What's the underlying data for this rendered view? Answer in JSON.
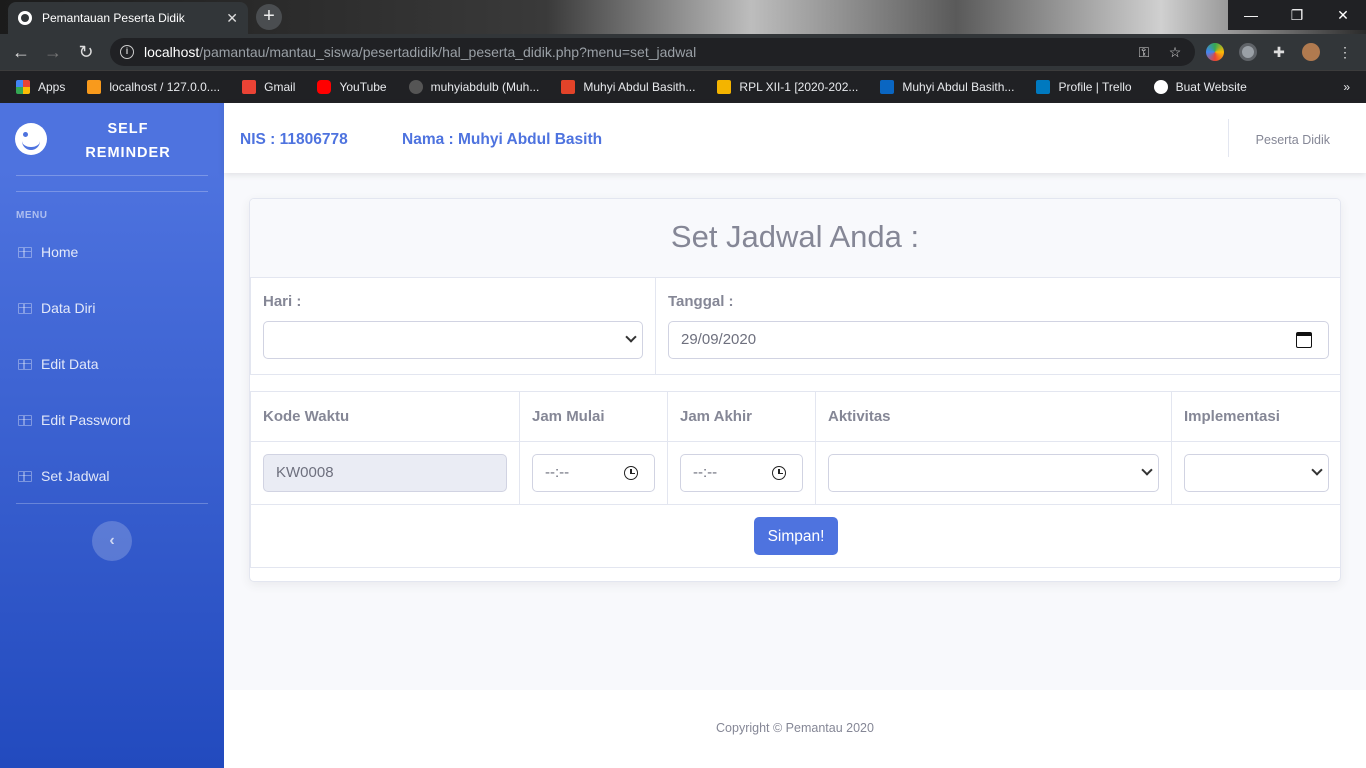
{
  "browser": {
    "tab_title": "Pemantauan Peserta Didik",
    "url_host": "localhost",
    "url_path": "/pamantau/mantau_siswa/pesertadidik/hal_peserta_didik.php?menu=set_jadwal",
    "bookmarks": [
      {
        "label": "Apps",
        "icon": "apps-grid-icon",
        "color": "#e8453c"
      },
      {
        "label": "localhost / 127.0.0....",
        "icon": "phpmyadmin-icon",
        "color": "#f89a1c"
      },
      {
        "label": "Gmail",
        "icon": "gmail-icon",
        "color": "#ea4335"
      },
      {
        "label": "YouTube",
        "icon": "youtube-icon",
        "color": "#ff0000"
      },
      {
        "label": "muhyiabdulb (Muh...",
        "icon": "github-icon",
        "color": "#555555"
      },
      {
        "label": "Muhyi Abdul Basith...",
        "icon": "gitlab-icon",
        "color": "#e24329"
      },
      {
        "label": "RPL XII-1 [2020-202...",
        "icon": "classroom-icon",
        "color": "#f4b400"
      },
      {
        "label": "Muhyi Abdul Basith...",
        "icon": "linkedin-icon",
        "color": "#0a66c2"
      },
      {
        "label": "Profile | Trello",
        "icon": "trello-icon",
        "color": "#0079bf"
      },
      {
        "label": "Buat Website",
        "icon": "globe-icon",
        "color": "#ffffff"
      }
    ]
  },
  "sidebar": {
    "brand_line1": "SELF",
    "brand_line2": "REMINDER",
    "menu_heading": "MENU",
    "items": [
      {
        "label": "Home"
      },
      {
        "label": "Data Diri"
      },
      {
        "label": "Edit Data"
      },
      {
        "label": "Edit Password"
      },
      {
        "label": "Set Jadwal"
      }
    ]
  },
  "topbar": {
    "nis": "NIS : 11806778",
    "nama": "Nama : Muhyi Abdul Basith",
    "user_role": "Peserta Didik"
  },
  "form": {
    "title": "Set Jadwal Anda :",
    "hari_label": "Hari :",
    "hari_value": "",
    "tanggal_label": "Tanggal :",
    "tanggal_value": "29/09/2020",
    "columns": [
      "Kode Waktu",
      "Jam Mulai",
      "Jam Akhir",
      "Aktivitas",
      "Implementasi"
    ],
    "kode_waktu": "KW0008",
    "jam_mulai": "--:--",
    "jam_akhir": "--:--",
    "aktivitas": "",
    "implementasi": "",
    "submit_label": "Simpan!"
  },
  "footer": {
    "text": "Copyright © Pemantau 2020"
  },
  "colors": {
    "primary": "#4e73df",
    "sidebar_bottom": "#224abe",
    "text_muted": "#858796"
  }
}
